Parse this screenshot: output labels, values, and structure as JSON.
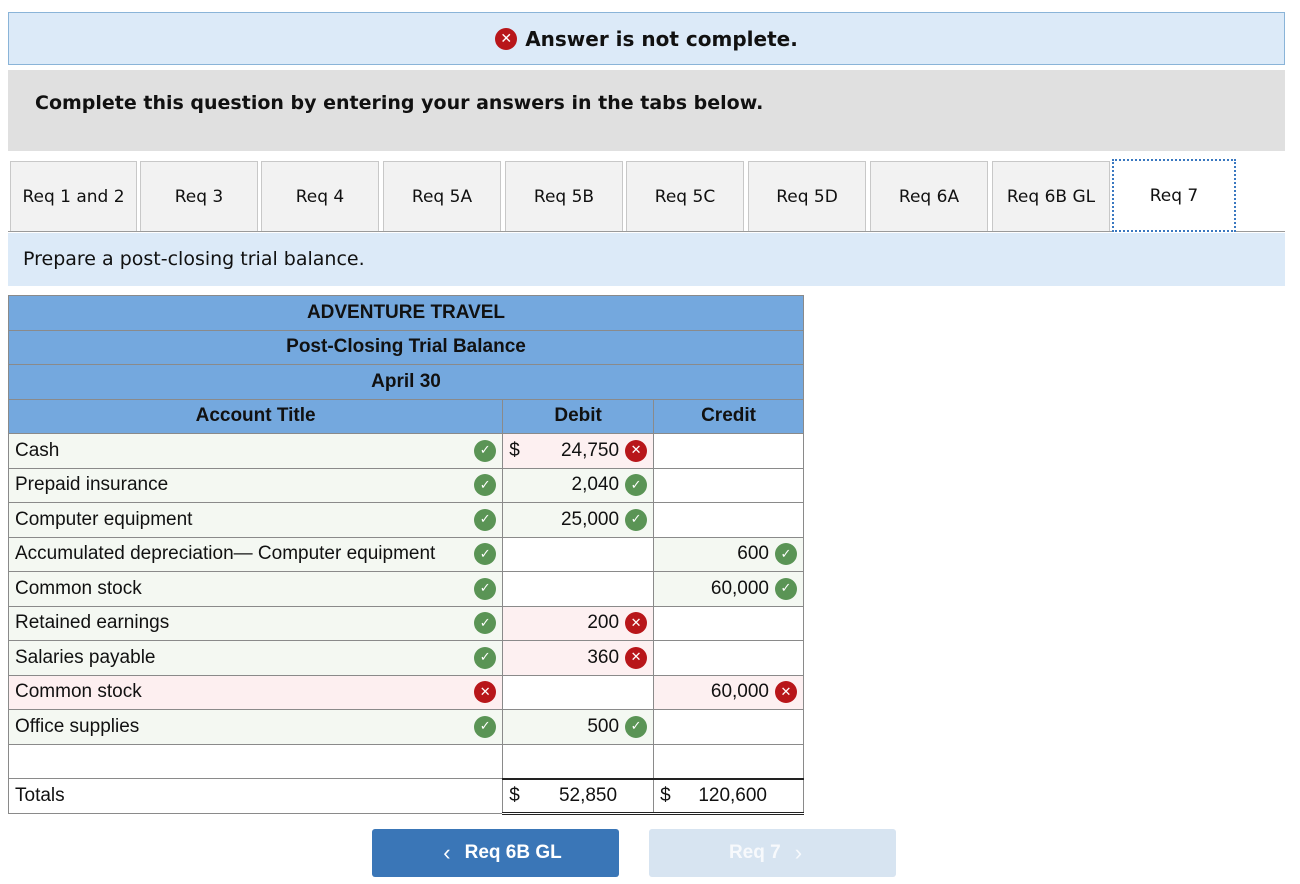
{
  "alert": {
    "icon": "x-circle-icon",
    "text": "Answer is not complete."
  },
  "instruction": "Complete this question by entering your answers in the tabs below.",
  "tabs": [
    {
      "label": "Req 1 and 2",
      "active": false
    },
    {
      "label": "Req 3",
      "active": false
    },
    {
      "label": "Req 4",
      "active": false
    },
    {
      "label": "Req 5A",
      "active": false
    },
    {
      "label": "Req 5B",
      "active": false
    },
    {
      "label": "Req 5C",
      "active": false
    },
    {
      "label": "Req 5D",
      "active": false
    },
    {
      "label": "Req 6A",
      "active": false
    },
    {
      "label": "Req 6B GL",
      "active": false
    },
    {
      "label": "Req 7",
      "active": true
    }
  ],
  "task": "Prepare a post-closing trial balance.",
  "table": {
    "company": "ADVENTURE TRAVEL",
    "title": "Post-Closing Trial Balance",
    "date": "April 30",
    "headers": {
      "account": "Account Title",
      "debit": "Debit",
      "credit": "Credit"
    },
    "rows": [
      {
        "account": "Cash",
        "account_status": "correct",
        "debit_prefix": "$",
        "debit": "24,750",
        "debit_status": "incorrect",
        "credit": "",
        "credit_status": ""
      },
      {
        "account": "Prepaid insurance",
        "account_status": "correct",
        "debit_prefix": "",
        "debit": "2,040",
        "debit_status": "correct",
        "credit": "",
        "credit_status": ""
      },
      {
        "account": "Computer equipment",
        "account_status": "correct",
        "debit_prefix": "",
        "debit": "25,000",
        "debit_status": "correct",
        "credit": "",
        "credit_status": ""
      },
      {
        "account": "Accumulated depreciation— Computer equipment",
        "account_status": "correct",
        "debit_prefix": "",
        "debit": "",
        "debit_status": "",
        "credit": "600",
        "credit_status": "correct"
      },
      {
        "account": "Common stock",
        "account_status": "correct",
        "debit_prefix": "",
        "debit": "",
        "debit_status": "",
        "credit": "60,000",
        "credit_status": "correct"
      },
      {
        "account": "Retained earnings",
        "account_status": "correct",
        "debit_prefix": "",
        "debit": "200",
        "debit_status": "incorrect",
        "credit": "",
        "credit_status": ""
      },
      {
        "account": "Salaries payable",
        "account_status": "correct",
        "debit_prefix": "",
        "debit": "360",
        "debit_status": "incorrect",
        "credit": "",
        "credit_status": ""
      },
      {
        "account": "Common stock",
        "account_status": "incorrect",
        "debit_prefix": "",
        "debit": "",
        "debit_status": "",
        "credit": "60,000",
        "credit_status": "incorrect"
      },
      {
        "account": "Office supplies",
        "account_status": "correct",
        "debit_prefix": "",
        "debit": "500",
        "debit_status": "correct",
        "credit": "",
        "credit_status": ""
      }
    ],
    "totals": {
      "label": "Totals",
      "debit_prefix": "$",
      "debit": "52,850",
      "credit_prefix": "$",
      "credit": "120,600"
    }
  },
  "nav": {
    "prev": {
      "label": "Req 6B GL",
      "icon": "chevron-left-icon",
      "glyph": "‹"
    },
    "next": {
      "label": "Req 7",
      "icon": "chevron-right-icon",
      "glyph": "›"
    }
  },
  "status_colors": {
    "correct": "#5a9455",
    "incorrect": "#b8161a",
    "header": "#74a8de",
    "accent": "#3a76b7"
  }
}
